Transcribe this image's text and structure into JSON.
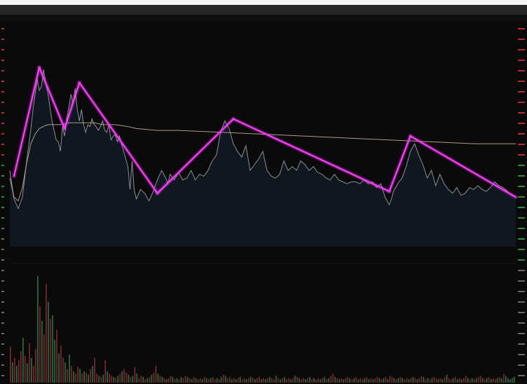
{
  "window": {
    "title": "",
    "info": ""
  },
  "colors": {
    "background": "#0a0a0a",
    "price_line": "#8a8f93",
    "price_fill": "#101a24",
    "average_line": "#c8b79a",
    "trend_lines": "#ff3cff",
    "volume_green": "#2d6b42",
    "volume_red": "#7a2a2a",
    "axis_text_up": "#b03030",
    "axis_text_down": "#2f8a3c"
  },
  "chart_data": {
    "type": "line",
    "title": "",
    "xlabel": "",
    "ylabel": "",
    "x_range": [
      0,
      240
    ],
    "price_range": [
      0,
      100
    ],
    "volume_range": [
      0,
      100
    ],
    "grid": false,
    "series": [
      {
        "role": "price",
        "points": [
          [
            0,
            40
          ],
          [
            2,
            25
          ],
          [
            4,
            20
          ],
          [
            6,
            26
          ],
          [
            8,
            45
          ],
          [
            10,
            62
          ],
          [
            11,
            72
          ],
          [
            12,
            80
          ],
          [
            13,
            88
          ],
          [
            14,
            82
          ],
          [
            15,
            84
          ],
          [
            16,
            93
          ],
          [
            17,
            86
          ],
          [
            18,
            81
          ],
          [
            20,
            66
          ],
          [
            22,
            56
          ],
          [
            23,
            55
          ],
          [
            24,
            50
          ],
          [
            25,
            63
          ],
          [
            26,
            58
          ],
          [
            27,
            67
          ],
          [
            28,
            73
          ],
          [
            29,
            80
          ],
          [
            30,
            75
          ],
          [
            31,
            83
          ],
          [
            32,
            72
          ],
          [
            33,
            66
          ],
          [
            34,
            72
          ],
          [
            35,
            64
          ],
          [
            36,
            60
          ],
          [
            37,
            64
          ],
          [
            38,
            63
          ],
          [
            39,
            67
          ],
          [
            40,
            64
          ],
          [
            41,
            63
          ],
          [
            42,
            61
          ],
          [
            43,
            63
          ],
          [
            44,
            66
          ],
          [
            45,
            61
          ],
          [
            46,
            60
          ],
          [
            47,
            64
          ],
          [
            48,
            56
          ],
          [
            49,
            58
          ],
          [
            50,
            59
          ],
          [
            51,
            55
          ],
          [
            52,
            58
          ],
          [
            53,
            54
          ],
          [
            54,
            50
          ],
          [
            56,
            42
          ],
          [
            57,
            30
          ],
          [
            58,
            45
          ],
          [
            59,
            30
          ],
          [
            60,
            25
          ],
          [
            62,
            30
          ],
          [
            64,
            28
          ],
          [
            66,
            24
          ],
          [
            68,
            29
          ],
          [
            70,
            35
          ],
          [
            72,
            40
          ],
          [
            74,
            36
          ],
          [
            75,
            33
          ],
          [
            76,
            38
          ],
          [
            78,
            35
          ],
          [
            80,
            39
          ],
          [
            82,
            35
          ],
          [
            84,
            36
          ],
          [
            86,
            40
          ],
          [
            88,
            35
          ],
          [
            90,
            38
          ],
          [
            92,
            37
          ],
          [
            94,
            40
          ],
          [
            96,
            45
          ],
          [
            98,
            48
          ],
          [
            100,
            60
          ],
          [
            102,
            66
          ],
          [
            104,
            62
          ],
          [
            106,
            54
          ],
          [
            108,
            50
          ],
          [
            110,
            47
          ],
          [
            112,
            53
          ],
          [
            114,
            40
          ],
          [
            116,
            43
          ],
          [
            118,
            46
          ],
          [
            120,
            50
          ],
          [
            122,
            40
          ],
          [
            124,
            37
          ],
          [
            126,
            36
          ],
          [
            128,
            38
          ],
          [
            130,
            45
          ],
          [
            132,
            40
          ],
          [
            134,
            42
          ],
          [
            136,
            40
          ],
          [
            138,
            45
          ],
          [
            140,
            43
          ],
          [
            142,
            40
          ],
          [
            144,
            42
          ],
          [
            146,
            39
          ],
          [
            148,
            38
          ],
          [
            150,
            36
          ],
          [
            152,
            35
          ],
          [
            154,
            38
          ],
          [
            156,
            35
          ],
          [
            158,
            34
          ],
          [
            160,
            33
          ],
          [
            162,
            34
          ],
          [
            164,
            34
          ],
          [
            166,
            33
          ],
          [
            168,
            35
          ],
          [
            170,
            33
          ],
          [
            172,
            34
          ],
          [
            174,
            31
          ],
          [
            176,
            33
          ],
          [
            178,
            26
          ],
          [
            180,
            22
          ],
          [
            181,
            25
          ],
          [
            182,
            29
          ],
          [
            184,
            33
          ],
          [
            186,
            36
          ],
          [
            188,
            42
          ],
          [
            190,
            50
          ],
          [
            192,
            54
          ],
          [
            194,
            48
          ],
          [
            196,
            43
          ],
          [
            198,
            36
          ],
          [
            200,
            40
          ],
          [
            202,
            32
          ],
          [
            204,
            38
          ],
          [
            206,
            33
          ],
          [
            208,
            30
          ],
          [
            210,
            28
          ],
          [
            212,
            31
          ],
          [
            214,
            27
          ],
          [
            216,
            28
          ],
          [
            218,
            31
          ],
          [
            220,
            30
          ],
          [
            222,
            32
          ],
          [
            224,
            30
          ],
          [
            226,
            29
          ],
          [
            228,
            31
          ],
          [
            230,
            34
          ],
          [
            232,
            32
          ],
          [
            234,
            31
          ],
          [
            236,
            29
          ],
          [
            238,
            27
          ],
          [
            240,
            26
          ]
        ]
      },
      {
        "role": "average",
        "points": [
          [
            0,
            36
          ],
          [
            2,
            26
          ],
          [
            4,
            24
          ],
          [
            6,
            31
          ],
          [
            8,
            44
          ],
          [
            10,
            54
          ],
          [
            12,
            59
          ],
          [
            14,
            62
          ],
          [
            16,
            63
          ],
          [
            18,
            64
          ],
          [
            20,
            64
          ],
          [
            24,
            64
          ],
          [
            28,
            65
          ],
          [
            32,
            65
          ],
          [
            36,
            65
          ],
          [
            40,
            65
          ],
          [
            44,
            64
          ],
          [
            50,
            64
          ],
          [
            56,
            63
          ],
          [
            60,
            62
          ],
          [
            70,
            61
          ],
          [
            80,
            61
          ],
          [
            100,
            60
          ],
          [
            120,
            59
          ],
          [
            140,
            58
          ],
          [
            160,
            57
          ],
          [
            180,
            56
          ],
          [
            200,
            55
          ],
          [
            220,
            54
          ],
          [
            240,
            54
          ]
        ]
      },
      {
        "role": "trend",
        "points": [
          [
            2,
            37
          ],
          [
            14,
            94
          ],
          [
            26,
            62
          ],
          [
            33,
            86
          ],
          [
            70,
            28
          ],
          [
            106,
            67
          ],
          [
            180,
            29
          ],
          [
            190,
            58
          ],
          [
            240,
            26
          ]
        ]
      }
    ],
    "volume": [
      32,
      18,
      22,
      15,
      20,
      28,
      40,
      24,
      17,
      35,
      22,
      15,
      30,
      95,
      68,
      55,
      43,
      88,
      72,
      57,
      60,
      38,
      47,
      26,
      33,
      22,
      18,
      12,
      25,
      15,
      10,
      8,
      14,
      12,
      8,
      10,
      9,
      7,
      12,
      15,
      22,
      8,
      6,
      5,
      7,
      20,
      10,
      8,
      6,
      5,
      4,
      6,
      8,
      10,
      12,
      9,
      7,
      5,
      6,
      14,
      8,
      4,
      6,
      5,
      3,
      4,
      5,
      7,
      9,
      15,
      8,
      6,
      5,
      4,
      3,
      4,
      6,
      5,
      3,
      4,
      3,
      5,
      4,
      6,
      5,
      4,
      3,
      5,
      4,
      3,
      4,
      3,
      5,
      4,
      3,
      4,
      5,
      3,
      4,
      3,
      5,
      7,
      6,
      4,
      5,
      3,
      4,
      3,
      4,
      5,
      3,
      4,
      3,
      4,
      5,
      4,
      3,
      4,
      5,
      3,
      4,
      3,
      4,
      5,
      4,
      3,
      6,
      4,
      3,
      4,
      5,
      3,
      4,
      3,
      4,
      6,
      5,
      4,
      3,
      4,
      3,
      4,
      5,
      3,
      4,
      3,
      4,
      3,
      4,
      5,
      3,
      4,
      6,
      8,
      5,
      4,
      3,
      4,
      3,
      4,
      5,
      4,
      3,
      4,
      5,
      3,
      4,
      3,
      4,
      5,
      3,
      4,
      3,
      4,
      5,
      4,
      3,
      4,
      5,
      3,
      6,
      5,
      4,
      3,
      4,
      5,
      4,
      3,
      4,
      3,
      4,
      5,
      4,
      3,
      4,
      6,
      5,
      3,
      4,
      3,
      4,
      5,
      4,
      3,
      4,
      3,
      5,
      7,
      4,
      3,
      4,
      5,
      3,
      4,
      3,
      4,
      6,
      4,
      3,
      4,
      3,
      4,
      5,
      6,
      4,
      3,
      4,
      5,
      3,
      4,
      3,
      4,
      5,
      4,
      8,
      6,
      4,
      3,
      4,
      5
    ],
    "volume_up": [
      true,
      false,
      true,
      false,
      true,
      true,
      false,
      true,
      false,
      true,
      false,
      true,
      true,
      false,
      true,
      false,
      true,
      true,
      false,
      true,
      false,
      false,
      true,
      false,
      true,
      true,
      false,
      true,
      false,
      true,
      false,
      true,
      true,
      false,
      true,
      false,
      true,
      false,
      true,
      false,
      true,
      true,
      false,
      true,
      false,
      true,
      false,
      true,
      true,
      false,
      true,
      false,
      true,
      false,
      true,
      true,
      false,
      true,
      false,
      true,
      false,
      true,
      true,
      false,
      true,
      false,
      true,
      false,
      true,
      true,
      false,
      true,
      false,
      true,
      false,
      true,
      true,
      false,
      true,
      false,
      true,
      false,
      true,
      true,
      false,
      true,
      false,
      true,
      false,
      true,
      true,
      false,
      true,
      false,
      true,
      false,
      true,
      true,
      false,
      true,
      false,
      true,
      false,
      true,
      true,
      false,
      true,
      false,
      true,
      false,
      true,
      true,
      false,
      true,
      false,
      true,
      false,
      true,
      true,
      false,
      true,
      false,
      true,
      false,
      true,
      true,
      false,
      true,
      false,
      true,
      false,
      true,
      true,
      false,
      true,
      false,
      true,
      false,
      true,
      true,
      false,
      true,
      false,
      true,
      false,
      true,
      true,
      false,
      true,
      false,
      true,
      false,
      true,
      true,
      false,
      true,
      false,
      true,
      false,
      true,
      true,
      false,
      true,
      false,
      true,
      false,
      true,
      true,
      false,
      true,
      false,
      true,
      false,
      true,
      true,
      false,
      true,
      false,
      true,
      false,
      true,
      true,
      false,
      true,
      false,
      true,
      false,
      true,
      true,
      false,
      true,
      false,
      true,
      false,
      true,
      true,
      false,
      true,
      false,
      true,
      false,
      true,
      true,
      false,
      true,
      false,
      true,
      false,
      true,
      true,
      false,
      true,
      false,
      true,
      false,
      true,
      true,
      false,
      true,
      false,
      true,
      false,
      true,
      true,
      false,
      true,
      false,
      true,
      false,
      true,
      true,
      false,
      true,
      false,
      true,
      false
    ]
  }
}
